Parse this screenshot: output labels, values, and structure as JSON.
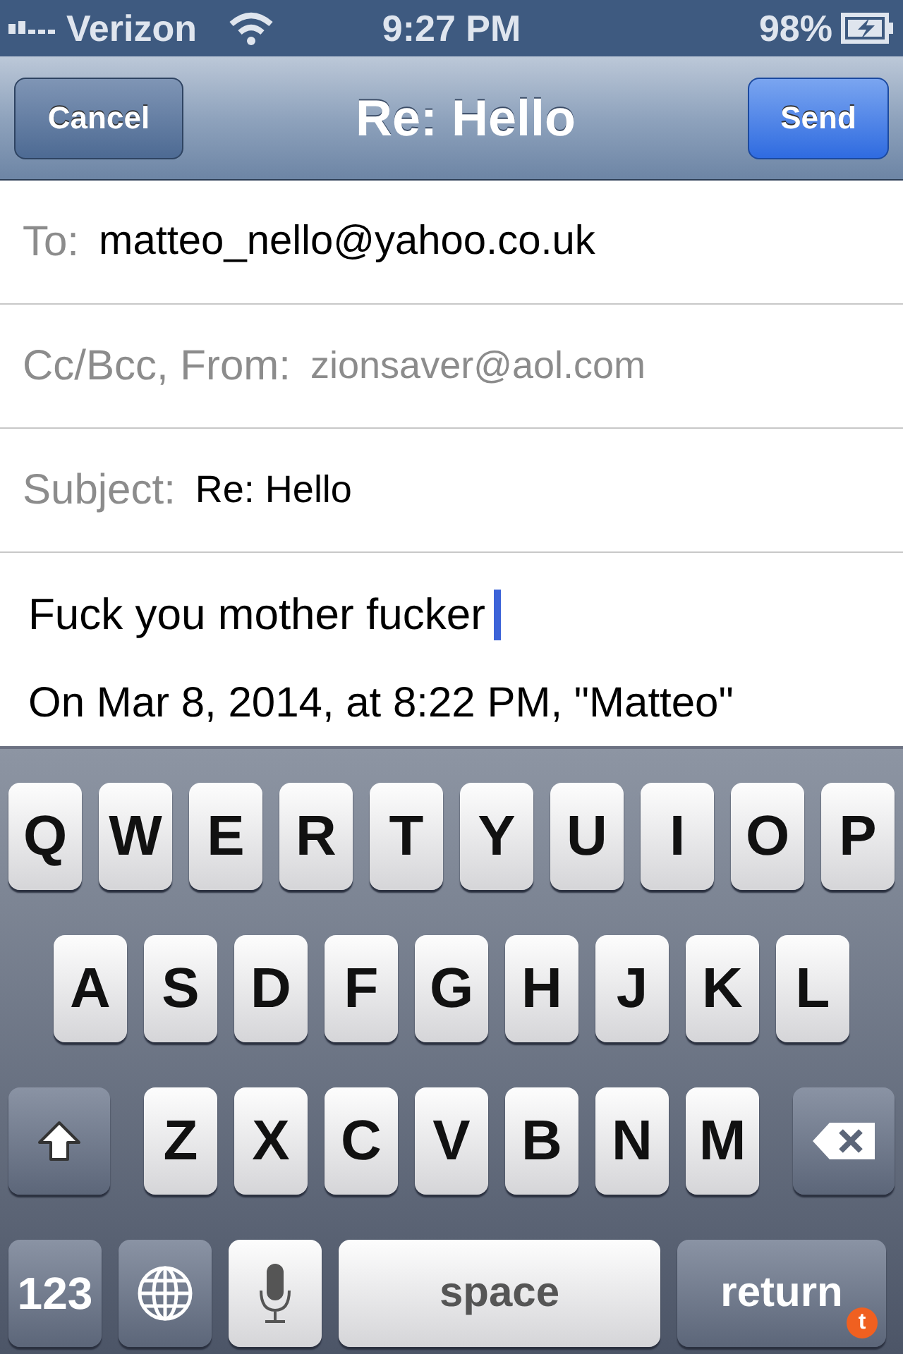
{
  "status_bar": {
    "carrier": "Verizon",
    "time": "9:27 PM",
    "battery": "98%"
  },
  "nav": {
    "cancel": "Cancel",
    "title": "Re: Hello",
    "send": "Send"
  },
  "fields": [
    {
      "label": "To:",
      "value": "matteo_nello@yahoo.co.uk",
      "kind": "recipient"
    },
    {
      "label": "Cc/Bcc, From:",
      "value": "zionsaver@aol.com",
      "kind": "muted"
    },
    {
      "label": "Subject:",
      "value": "Re: Hello",
      "kind": "subject"
    }
  ],
  "body": {
    "text": "Fuck you mother fucker",
    "quoted": "On Mar 8, 2014, at 8:22 PM, \"Matteo\""
  },
  "keyboard": [
    [
      {
        "kind": "letter",
        "label": "Q"
      },
      {
        "kind": "letter",
        "label": "W"
      },
      {
        "kind": "letter",
        "label": "E"
      },
      {
        "kind": "letter",
        "label": "R"
      },
      {
        "kind": "letter",
        "label": "T"
      },
      {
        "kind": "letter",
        "label": "Y"
      },
      {
        "kind": "letter",
        "label": "U"
      },
      {
        "kind": "letter",
        "label": "I"
      },
      {
        "kind": "letter",
        "label": "O"
      },
      {
        "kind": "letter",
        "label": "P"
      }
    ],
    [
      {
        "kind": "letter",
        "label": "A"
      },
      {
        "kind": "letter",
        "label": "S"
      },
      {
        "kind": "letter",
        "label": "D"
      },
      {
        "kind": "letter",
        "label": "F"
      },
      {
        "kind": "letter",
        "label": "G"
      },
      {
        "kind": "letter",
        "label": "H"
      },
      {
        "kind": "letter",
        "label": "J"
      },
      {
        "kind": "letter",
        "label": "K"
      },
      {
        "kind": "letter",
        "label": "L"
      }
    ],
    [
      {
        "kind": "shift"
      },
      {
        "kind": "letter",
        "label": "Z"
      },
      {
        "kind": "letter",
        "label": "X"
      },
      {
        "kind": "letter",
        "label": "C"
      },
      {
        "kind": "letter",
        "label": "V"
      },
      {
        "kind": "letter",
        "label": "B"
      },
      {
        "kind": "letter",
        "label": "N"
      },
      {
        "kind": "letter",
        "label": "M"
      },
      {
        "kind": "delete"
      }
    ],
    [
      {
        "kind": "mode",
        "label": "123"
      },
      {
        "kind": "globe"
      },
      {
        "kind": "mic"
      },
      {
        "kind": "space",
        "label": "space"
      },
      {
        "kind": "return",
        "label": "return",
        "badge": "t"
      }
    ]
  ]
}
